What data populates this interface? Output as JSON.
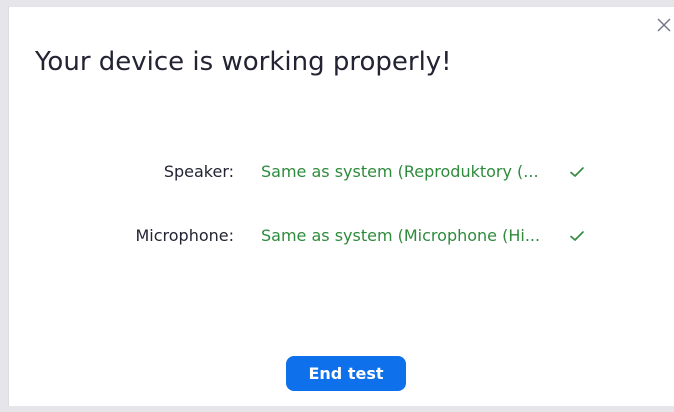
{
  "dialog": {
    "title": "Your device is working properly!",
    "close_icon": "close-icon"
  },
  "devices": [
    {
      "label": "Speaker:",
      "value": "Same as system (Reproduktory (...",
      "status_icon": "checkmark-icon"
    },
    {
      "label": "Microphone:",
      "value": "Same as system (Microphone (Hi...",
      "status_icon": "checkmark-icon"
    }
  ],
  "actions": {
    "end_test_label": "End test"
  },
  "colors": {
    "title_text": "#232333",
    "device_value": "#2e8b3c",
    "primary_button": "#0e71eb",
    "backdrop": "#e6e6ea"
  }
}
